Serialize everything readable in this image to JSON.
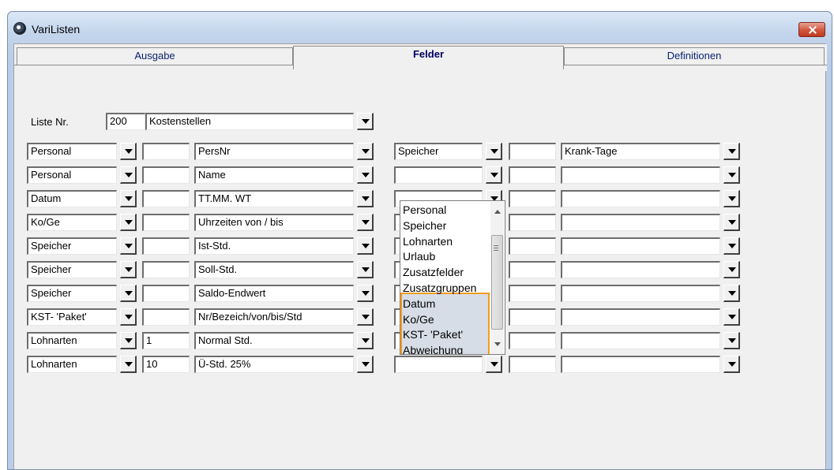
{
  "window": {
    "title": "VariListen"
  },
  "tabs": [
    "Ausgabe",
    "Felder",
    "Definitionen"
  ],
  "header": {
    "label": "Liste Nr.",
    "number": "200",
    "name": "Kostenstellen"
  },
  "left_rows": [
    {
      "type": "Personal",
      "num": "",
      "field": "PersNr"
    },
    {
      "type": "Personal",
      "num": "",
      "field": "Name"
    },
    {
      "type": "Datum",
      "num": "",
      "field": "TT.MM.  WT"
    },
    {
      "type": "Ko/Ge",
      "num": "",
      "field": "Uhrzeiten von / bis"
    },
    {
      "type": "Speicher",
      "num": "",
      "field": "Ist-Std."
    },
    {
      "type": "Speicher",
      "num": "",
      "field": "Soll-Std."
    },
    {
      "type": "Speicher",
      "num": "",
      "field": "Saldo-Endwert"
    },
    {
      "type": "KST- 'Paket'",
      "num": "",
      "field": "Nr/Bezeich/von/bis/Std"
    },
    {
      "type": "Lohnarten",
      "num": "1",
      "field": "Normal Std."
    },
    {
      "type": "Lohnarten",
      "num": "10",
      "field": "Ü-Std. 25%"
    }
  ],
  "right_rows": [
    {
      "type": "Speicher",
      "num": "",
      "field": "Krank-Tage"
    },
    {
      "type": "",
      "num": "",
      "field": ""
    },
    {
      "type": "",
      "num": "",
      "field": ""
    },
    {
      "type": "",
      "num": "",
      "field": ""
    },
    {
      "type": "",
      "num": "",
      "field": ""
    },
    {
      "type": "",
      "num": "",
      "field": ""
    },
    {
      "type": "",
      "num": "",
      "field": ""
    },
    {
      "type": "",
      "num": "",
      "field": ""
    },
    {
      "type": "",
      "num": "",
      "field": ""
    },
    {
      "type": "",
      "num": "",
      "field": ""
    }
  ],
  "dropdown": {
    "items": [
      "Personal",
      "Speicher",
      "Lohnarten",
      "Urlaub",
      "Zusatzfelder",
      "Zusatzgruppen",
      "Datum",
      "Ko/Ge",
      "KST- 'Paket'",
      "Abweichung"
    ],
    "highlighted_from_index": 6,
    "highlight_color": "#f39c1a"
  },
  "colors": {
    "window_frame": "#b9cde8",
    "tab_text": "#0a1e6e",
    "close_button": "#c13a22"
  }
}
